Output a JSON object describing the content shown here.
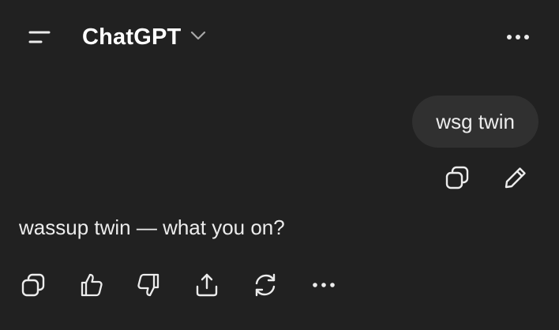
{
  "header": {
    "title": "ChatGPT",
    "menu_icon": "sidebar-menu-icon",
    "model_chevron_icon": "chevron-down-icon",
    "more_icon": "more-horizontal-icon"
  },
  "conversation": {
    "user_message": {
      "text": "wsg twin",
      "actions": [
        "copy-icon",
        "edit-pencil-icon"
      ]
    },
    "assistant_message": {
      "text": "wassup twin — what you on?",
      "actions": [
        "copy-icon",
        "thumbs-up-icon",
        "thumbs-down-icon",
        "share-icon",
        "regenerate-icon",
        "more-horizontal-icon"
      ]
    }
  },
  "colors": {
    "background": "#212121",
    "user_bubble": "#303030",
    "text": "#ececec",
    "icon": "#ececec"
  }
}
